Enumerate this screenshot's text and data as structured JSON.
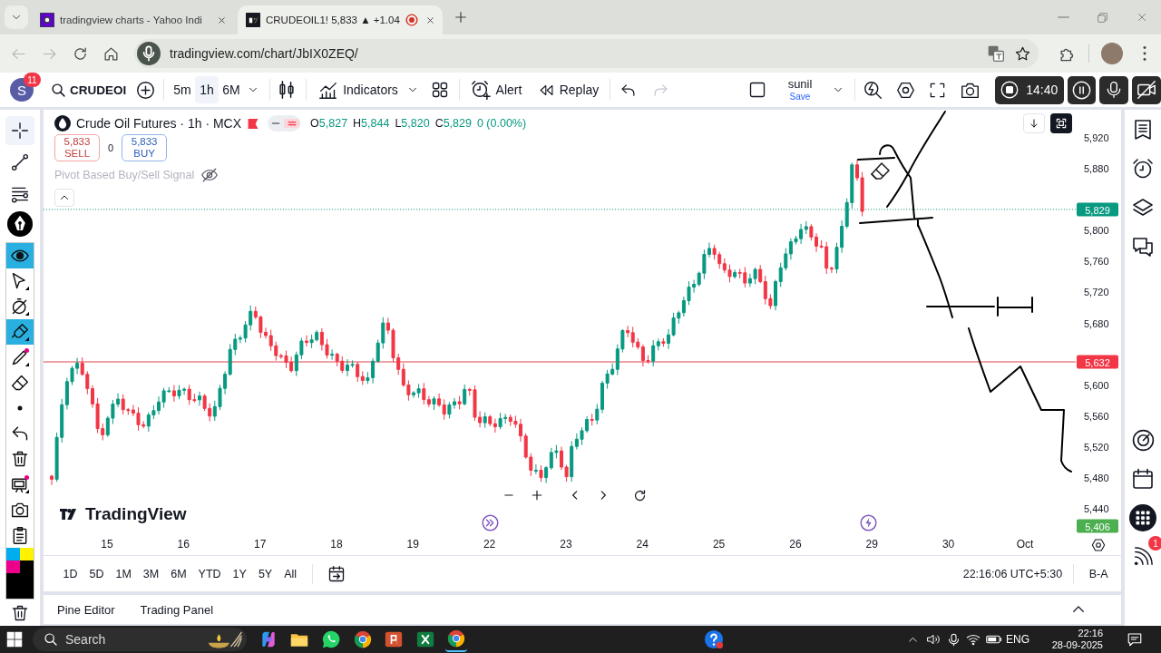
{
  "browser": {
    "nav": [
      {
        "kind": "back",
        "disabled": true
      },
      {
        "kind": "forward",
        "disabled": true
      }
    ],
    "tabs": [
      {
        "title": "tradingview charts - Yahoo Indi",
        "selected": false,
        "recording": false
      },
      {
        "title": "CRUDEOIL1! 5,833 ▲ +1.04",
        "selected": true,
        "recording": true
      }
    ],
    "url": "tradingview.com/chart/JbIX0ZEQ/"
  },
  "toolbar": {
    "avatar": "S",
    "badge": "11",
    "symbol": "CRUDEOI",
    "intervals": [
      {
        "label": "5m",
        "selected": false
      },
      {
        "label": "1h",
        "selected": true
      },
      {
        "label": "6M",
        "selected": false
      }
    ],
    "indicators": "Indicators",
    "alert": "Alert",
    "replay": "Replay",
    "history": [
      {
        "kind": "undo",
        "disabled": false
      },
      {
        "kind": "redo",
        "disabled": true
      }
    ],
    "layout_name": "sunil",
    "save": "Save"
  },
  "recorder": {
    "elapsed": "14:40"
  },
  "chart_tools": [
    {
      "kind": "crosshair",
      "selected": true
    },
    {
      "kind": "trendline",
      "selected": false
    },
    {
      "kind": "fib",
      "selected": false
    }
  ],
  "annotation_tools": [
    {
      "kind": "hide",
      "selected": true
    },
    {
      "kind": "select",
      "selected": false
    },
    {
      "kind": "timer",
      "selected": false
    },
    {
      "kind": "highlighter",
      "selected": true
    },
    {
      "kind": "pen",
      "selected": false
    },
    {
      "kind": "eraser",
      "selected": false
    },
    {
      "kind": "size",
      "selected": false
    },
    {
      "kind": "undo",
      "selected": false
    },
    {
      "kind": "clear",
      "selected": false
    },
    {
      "kind": "board",
      "selected": false
    },
    {
      "kind": "capture",
      "selected": false
    },
    {
      "kind": "notes",
      "selected": false
    }
  ],
  "palette": [
    {
      "kind": "swatch",
      "color": "#00aeef"
    },
    {
      "kind": "swatch",
      "color": "#fff200"
    },
    {
      "kind": "swatch",
      "color": "#ec008c"
    },
    {
      "kind": "swatch",
      "color": "#000000"
    },
    {
      "kind": "current",
      "color": "#000000"
    }
  ],
  "chart": {
    "title": "Crude Oil Futures · 1h · MCX",
    "ohlc": [
      {
        "label": "O",
        "value": "5,827"
      },
      {
        "label": "H",
        "value": "5,844"
      },
      {
        "label": "L",
        "value": "5,820"
      },
      {
        "label": "C",
        "value": "5,829"
      }
    ],
    "change": "0 (0.00%)",
    "sell": {
      "price": "5,833",
      "label": "SELL"
    },
    "spread": "0",
    "buy": {
      "price": "5,833",
      "label": "BUY"
    },
    "indicator": {
      "name": "Pivot Based Buy/Sell Signal",
      "visible": false
    },
    "logo": "TradingView",
    "price_labels": [
      "5,920",
      "5,880",
      "5,800",
      "5,760",
      "5,720",
      "5,680",
      "5,600",
      "5,560",
      "5,520",
      "5,480",
      "5,440"
    ],
    "price_tags": [
      {
        "value": "5,829",
        "color": "#089981"
      },
      {
        "value": "5,632",
        "color": "#f23645"
      },
      {
        "value": "5,406",
        "color": "#4caf50"
      }
    ],
    "date_labels": [
      "15",
      "16",
      "17",
      "18",
      "19",
      "22",
      "23",
      "24",
      "25",
      "26",
      "29",
      "30",
      "Oct"
    ]
  },
  "range_bar": {
    "ranges": [
      "1D",
      "5D",
      "1M",
      "3M",
      "6M",
      "YTD",
      "1Y",
      "5Y",
      "All"
    ],
    "time": "22:16:06 UTC+5:30",
    "adjustment": "B-A"
  },
  "bottom_panel": {
    "tabs": [
      "Pine Editor",
      "Trading Panel"
    ]
  },
  "sidebar": {
    "badge": "1"
  },
  "taskbar": {
    "search": {
      "placeholder": "Search"
    },
    "language": "ENG",
    "time": "22:16",
    "date": "28-09-2025"
  }
}
